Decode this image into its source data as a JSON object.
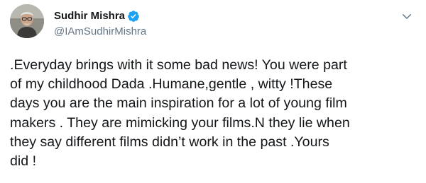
{
  "author": {
    "display_name": "Sudhir Mishra",
    "handle": "@IAmSudhirMishra",
    "verified": true,
    "avatar_icon": "profile-photo",
    "verified_icon": "verified-badge-icon",
    "menu_icon": "chevron-down-icon"
  },
  "tweet": {
    "lines": [
      ".Everyday brings with it some bad news! You were part",
      "of my childhood Dada .Humane,gentle , witty !These",
      "days you are the main inspiration for a lot of young film",
      "makers . They are mimicking your films.N they lie when",
      "they say different films didn’t work in the past .Yours",
      "did !"
    ]
  },
  "colors": {
    "name_text": "#14171a",
    "handle_text": "#657786",
    "verified_blue": "#1da1f2",
    "caret_gray": "#657786"
  }
}
